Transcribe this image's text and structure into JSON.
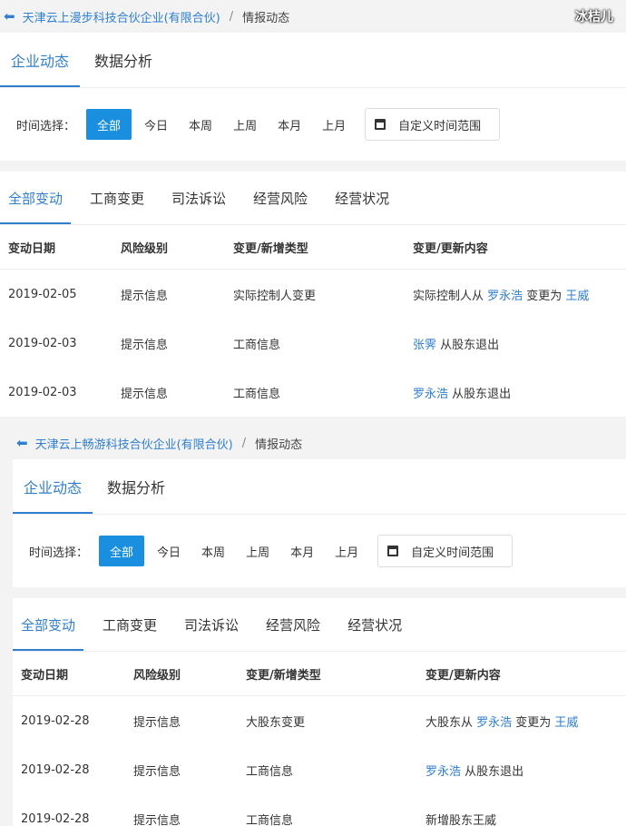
{
  "watermark": "冰桔儿",
  "screens": [
    {
      "breadcrumb": {
        "company": "天津云上漫步科技合伙企业(有限合伙)",
        "separator": "/",
        "current": "情报动态"
      },
      "top_tabs": [
        "企业动态",
        "数据分析"
      ],
      "filter": {
        "label": "时间选择：",
        "options": [
          "全部",
          "今日",
          "本周",
          "上周",
          "本月",
          "上月"
        ],
        "custom_range": "自定义时间范围"
      },
      "sub_tabs": [
        "全部变动",
        "工商变更",
        "司法诉讼",
        "经营风险",
        "经营状况"
      ],
      "table": {
        "headers": [
          "变动日期",
          "风险级别",
          "变更/新增类型",
          "变更/更新内容"
        ],
        "rows": [
          {
            "date": "2019-02-05",
            "risk": "提示信息",
            "type": "实际控制人变更",
            "content_pre": "实际控制人从 ",
            "content_a": "罗永浩",
            "content_mid": " 变更为 ",
            "content_b": "王威",
            "content_post": ""
          },
          {
            "date": "2019-02-03",
            "risk": "提示信息",
            "type": "工商信息",
            "content_pre": "",
            "content_a": "张霁",
            "content_mid": " 从股东退出",
            "content_b": "",
            "content_post": ""
          },
          {
            "date": "2019-02-03",
            "risk": "提示信息",
            "type": "工商信息",
            "content_pre": "",
            "content_a": "罗永浩",
            "content_mid": " 从股东退出",
            "content_b": "",
            "content_post": ""
          }
        ]
      }
    },
    {
      "breadcrumb": {
        "company": "天津云上畅游科技合伙企业(有限合伙)",
        "separator": "/",
        "current": "情报动态"
      },
      "top_tabs": [
        "企业动态",
        "数据分析"
      ],
      "filter": {
        "label": "时间选择：",
        "options": [
          "全部",
          "今日",
          "本周",
          "上周",
          "本月",
          "上月"
        ],
        "custom_range": "自定义时间范围"
      },
      "sub_tabs": [
        "全部变动",
        "工商变更",
        "司法诉讼",
        "经营风险",
        "经营状况"
      ],
      "table": {
        "headers": [
          "变动日期",
          "风险级别",
          "变更/新增类型",
          "变更/更新内容"
        ],
        "rows": [
          {
            "date": "2019-02-28",
            "risk": "提示信息",
            "type": "大股东变更",
            "content_pre": "大股东从 ",
            "content_a": "罗永浩",
            "content_mid": " 变更为 ",
            "content_b": "王威",
            "content_post": ""
          },
          {
            "date": "2019-02-28",
            "risk": "提示信息",
            "type": "工商信息",
            "content_pre": "",
            "content_a": "罗永浩",
            "content_mid": " 从股东退出",
            "content_b": "",
            "content_post": ""
          },
          {
            "date": "2019-02-28",
            "risk": "提示信息",
            "type": "工商信息",
            "content_pre": "新增股东王威",
            "content_a": "",
            "content_mid": "",
            "content_b": "",
            "content_post": ""
          }
        ]
      }
    }
  ]
}
